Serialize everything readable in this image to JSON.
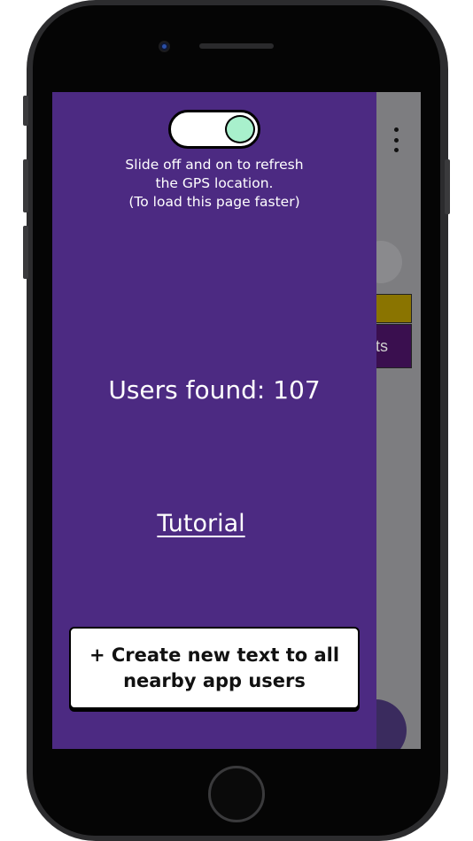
{
  "drawer": {
    "refresh_lines": [
      "Slide off and on to refresh",
      "the GPS location.",
      "(To load this page faster)"
    ],
    "users_found": "Users found: 107",
    "tutorial_label": "Tutorial",
    "create_button": {
      "line1": "+ Create new text to all",
      "line2": "nearby app users"
    },
    "toggle_on": true
  },
  "background_app": {
    "partial_label": "ts"
  },
  "colors": {
    "drawer_bg": "#4c2a82",
    "toggle_knob": "#a8f0cc",
    "bg_bar_gold": "#8a7400",
    "bg_bar_purple": "#3a0f4f"
  }
}
